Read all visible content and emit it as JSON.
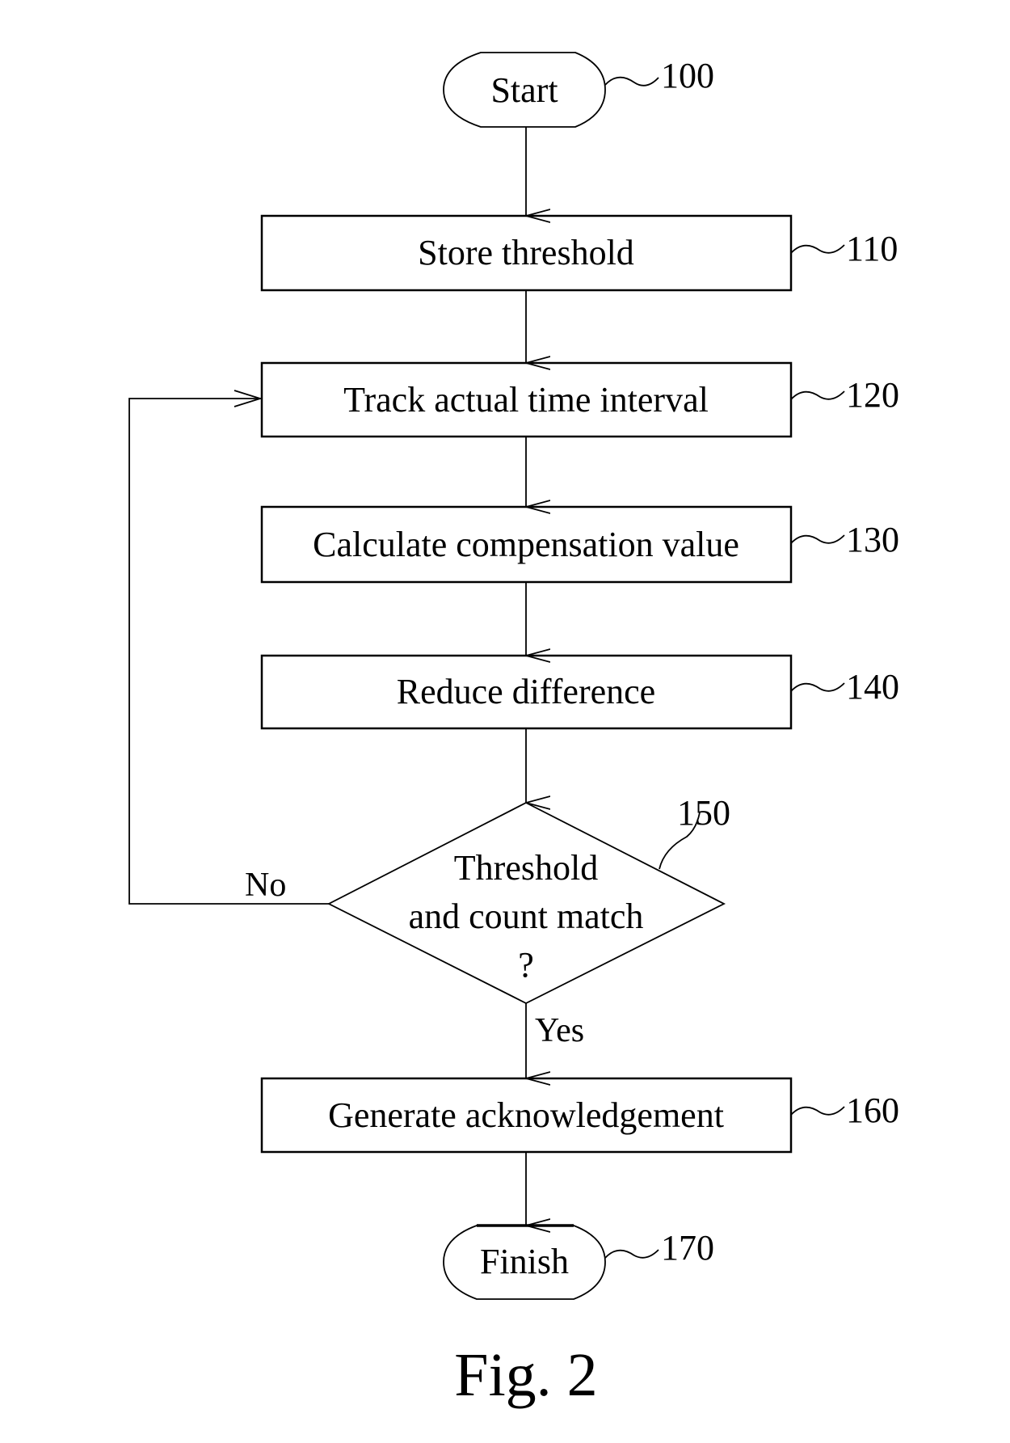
{
  "figure": {
    "caption": "Fig. 2",
    "nodes": [
      {
        "id": "100",
        "type": "terminal",
        "label": "Start",
        "ref": "100"
      },
      {
        "id": "110",
        "type": "process",
        "label": "Store threshold",
        "ref": "110"
      },
      {
        "id": "120",
        "type": "process",
        "label": "Track actual time interval",
        "ref": "120"
      },
      {
        "id": "130",
        "type": "process",
        "label": "Calculate compensation value",
        "ref": "130"
      },
      {
        "id": "140",
        "type": "process",
        "label": "Reduce difference",
        "ref": "140"
      },
      {
        "id": "150",
        "type": "decision",
        "label_lines": [
          "Threshold",
          "and count match",
          "?"
        ],
        "ref": "150"
      },
      {
        "id": "160",
        "type": "process",
        "label": "Generate acknowledgement",
        "ref": "160"
      },
      {
        "id": "170",
        "type": "terminal",
        "label": "Finish",
        "ref": "170"
      }
    ],
    "edges": [
      {
        "from": "100",
        "to": "110",
        "label": ""
      },
      {
        "from": "110",
        "to": "120",
        "label": ""
      },
      {
        "from": "120",
        "to": "130",
        "label": ""
      },
      {
        "from": "130",
        "to": "140",
        "label": ""
      },
      {
        "from": "140",
        "to": "150",
        "label": ""
      },
      {
        "from": "150",
        "to": "120",
        "label": "No"
      },
      {
        "from": "150",
        "to": "160",
        "label": "Yes"
      },
      {
        "from": "160",
        "to": "170",
        "label": ""
      }
    ]
  }
}
